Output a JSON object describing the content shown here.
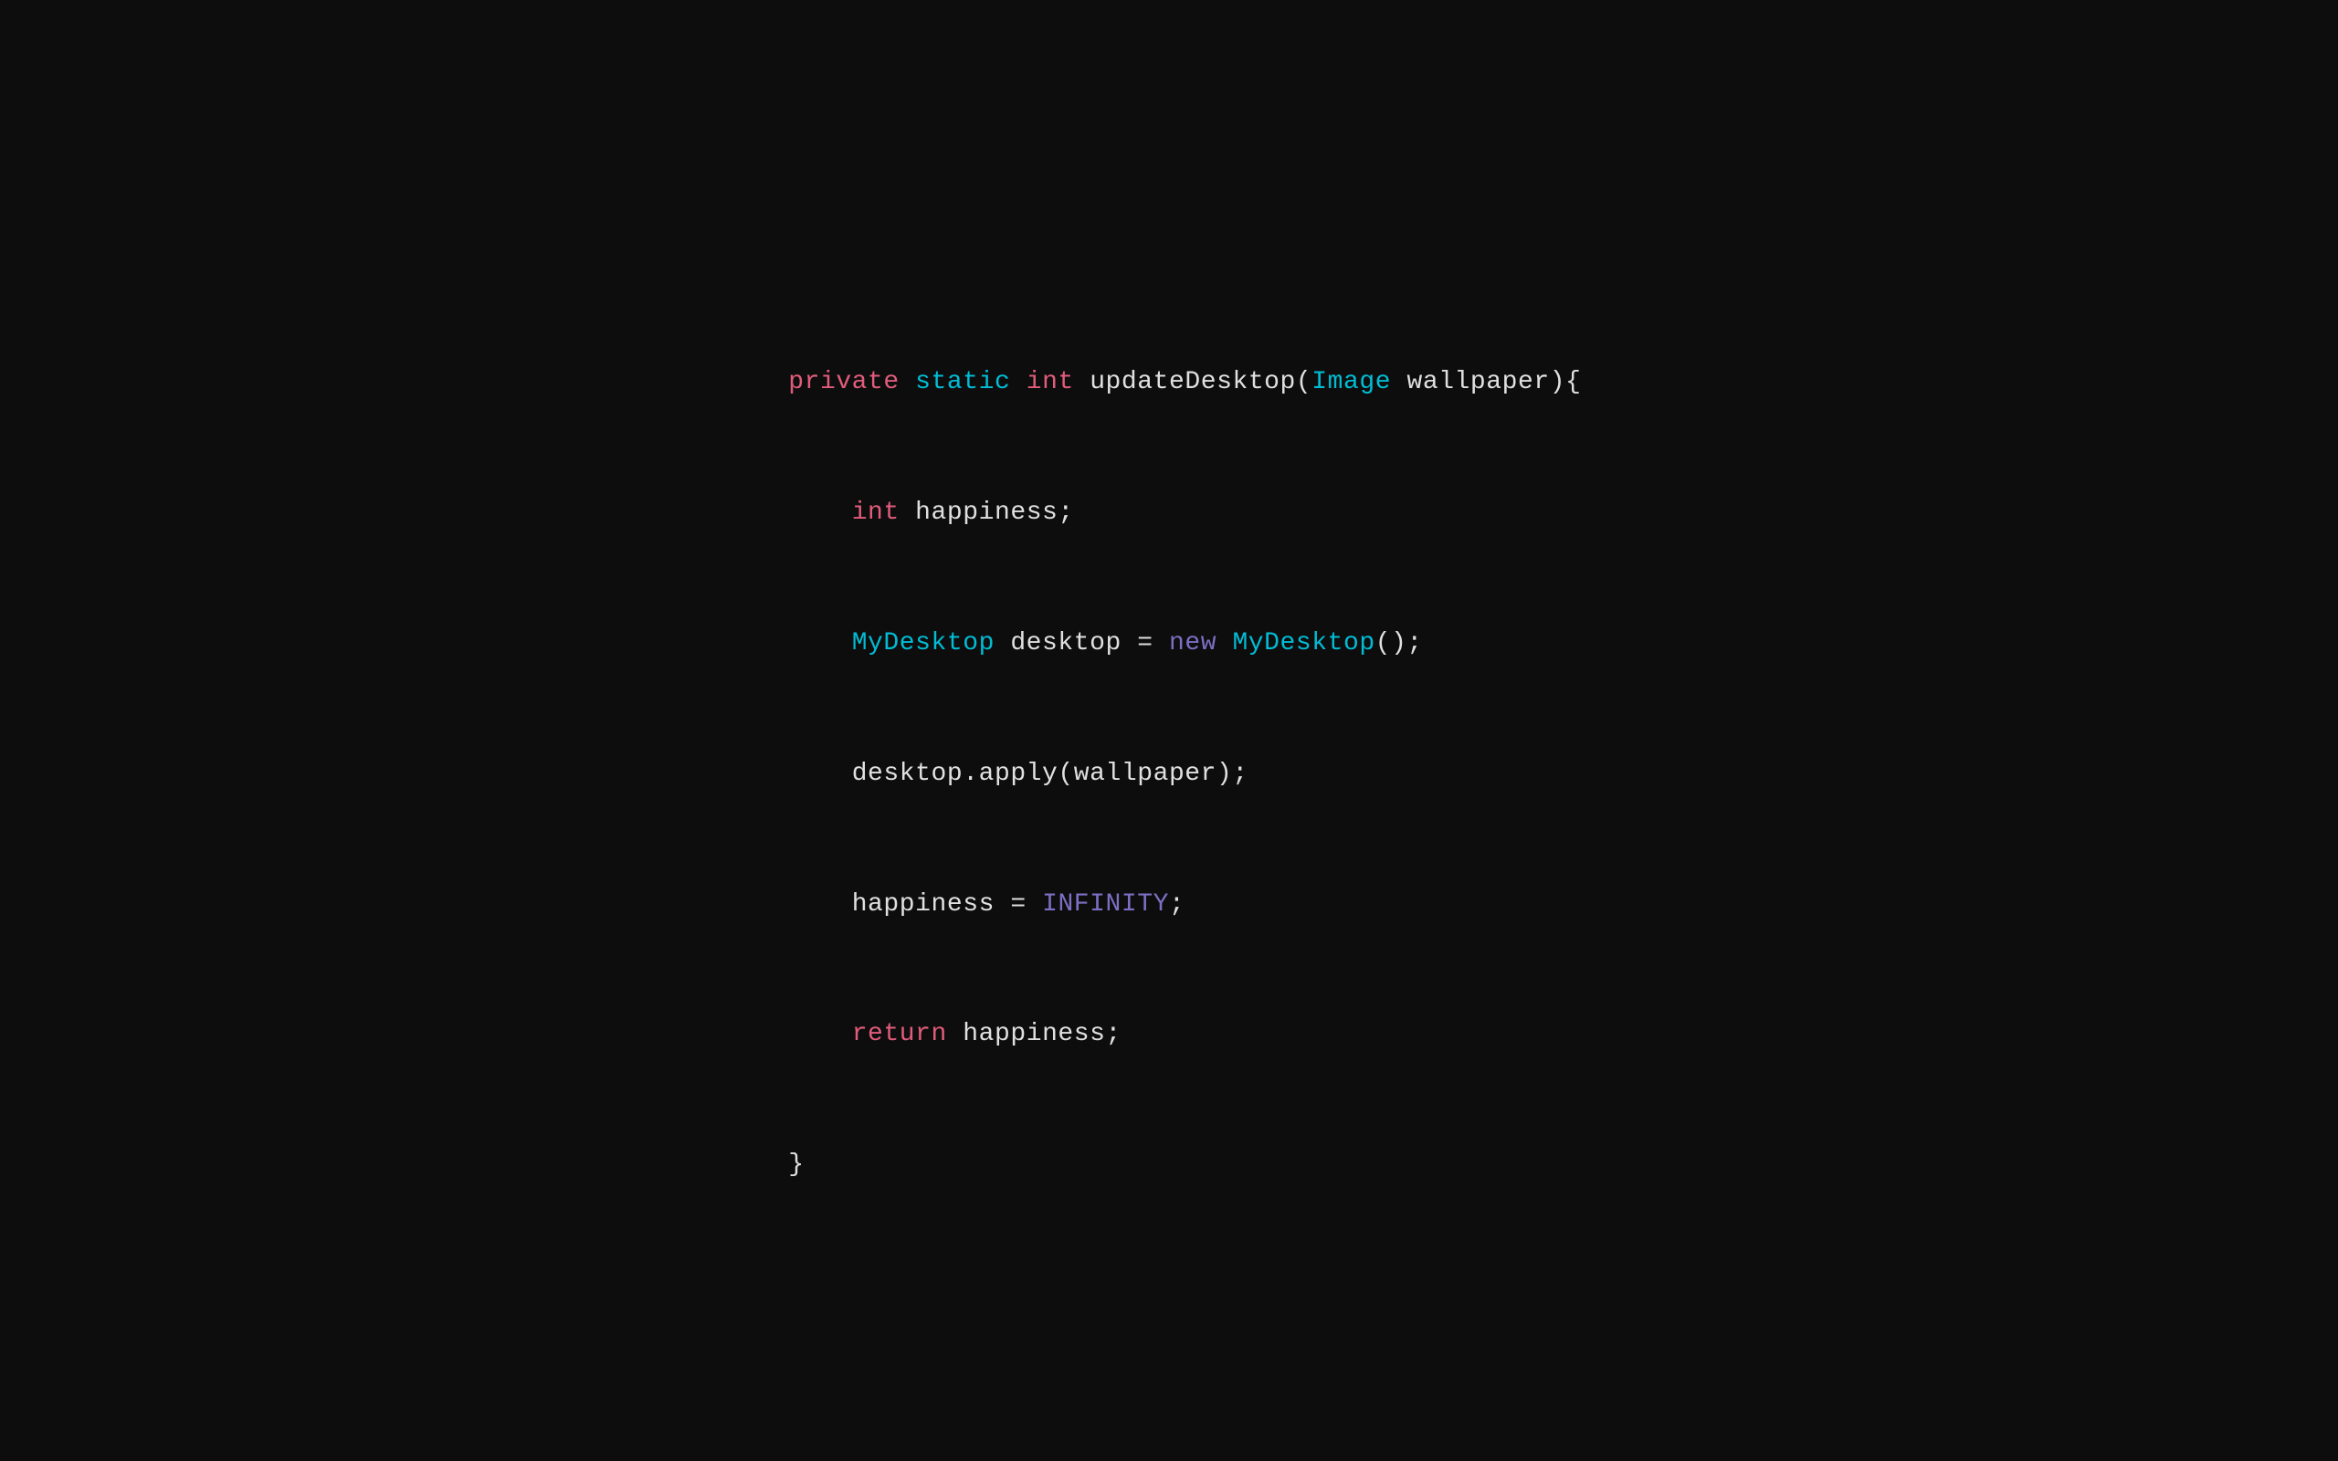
{
  "code": {
    "line1": {
      "kw_private": "private",
      "kw_static": "static",
      "kw_int": "int",
      "method": "updateDesktop",
      "paren_open": "(",
      "class_image": "Image",
      "param": "wallpaper",
      "paren_close": ")",
      "brace_open": "{"
    },
    "line2": {
      "kw_int": "int",
      "rest": "happiness;"
    },
    "line3": {
      "class": "MyDesktop",
      "var": "desktop",
      "eq": "=",
      "kw_new": "new",
      "class2": "MyDesktop",
      "rest": "();"
    },
    "line4": {
      "text": "desktop.apply(wallpaper);"
    },
    "line5": {
      "var": "happiness",
      "eq": "=",
      "const": "INFINITY",
      "semi": ";"
    },
    "line6": {
      "kw_return": "return",
      "rest": "happiness;"
    },
    "line7": {
      "brace_close": "}"
    }
  }
}
